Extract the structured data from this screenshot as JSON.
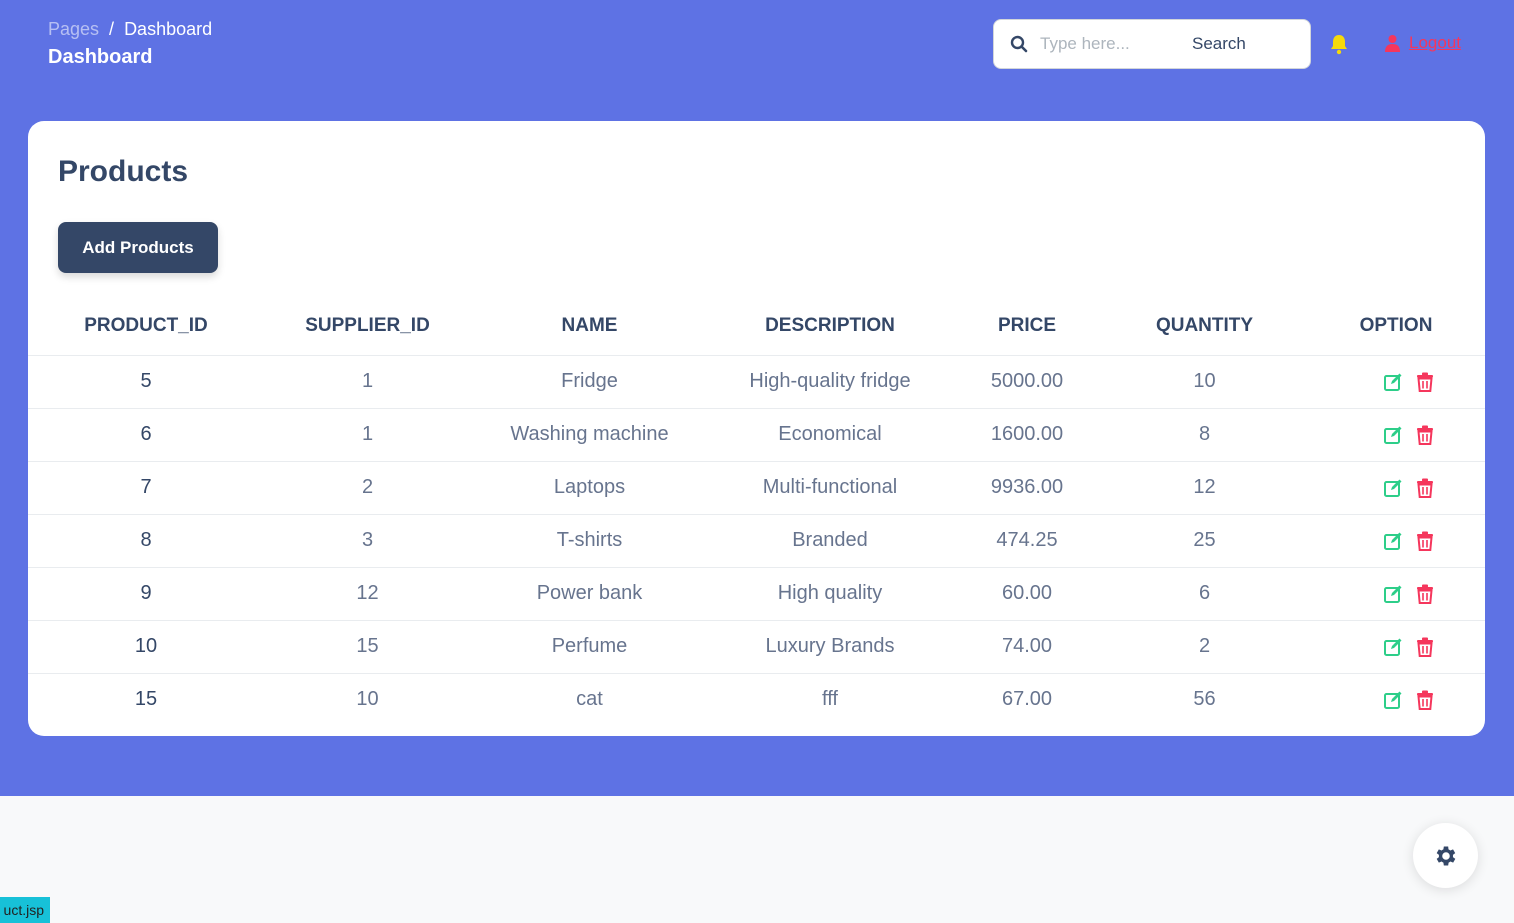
{
  "breadcrumb": {
    "parent": "Pages",
    "separator": "/",
    "current": "Dashboard"
  },
  "header": {
    "title": "Dashboard"
  },
  "search": {
    "placeholder": "Type here...",
    "button_label": "Search",
    "icon": "search-icon"
  },
  "notifications": {
    "icon": "bell-icon",
    "color": "#f5d90a"
  },
  "logout": {
    "label": "Logout",
    "icon": "user-icon",
    "color": "#f5365c"
  },
  "card": {
    "title": "Products",
    "add_button_label": "Add Products"
  },
  "table": {
    "columns": [
      "PRODUCT_ID",
      "SUPPLIER_ID",
      "NAME",
      "DESCRIPTION",
      "PRICE",
      "QUANTITY",
      "OPTION"
    ],
    "rows": [
      {
        "product_id": "5",
        "supplier_id": "1",
        "name": "Fridge",
        "description": "High-quality fridge",
        "price": "5000.00",
        "quantity": "10"
      },
      {
        "product_id": "6",
        "supplier_id": "1",
        "name": "Washing machine",
        "description": "Economical",
        "price": "1600.00",
        "quantity": "8"
      },
      {
        "product_id": "7",
        "supplier_id": "2",
        "name": "Laptops",
        "description": "Multi-functional",
        "price": "9936.00",
        "quantity": "12"
      },
      {
        "product_id": "8",
        "supplier_id": "3",
        "name": "T-shirts",
        "description": "Branded",
        "price": "474.25",
        "quantity": "25"
      },
      {
        "product_id": "9",
        "supplier_id": "12",
        "name": "Power bank",
        "description": "High quality",
        "price": "60.00",
        "quantity": "6"
      },
      {
        "product_id": "10",
        "supplier_id": "15",
        "name": "Perfume",
        "description": "Luxury Brands",
        "price": "74.00",
        "quantity": "2"
      },
      {
        "product_id": "15",
        "supplier_id": "10",
        "name": "cat",
        "description": "fff",
        "price": "67.00",
        "quantity": "56"
      }
    ],
    "option_icons": {
      "edit": "edit-icon",
      "delete": "trash-icon",
      "edit_color": "#2dce89",
      "delete_color": "#f5365c"
    }
  },
  "settings_fab": {
    "icon": "gear-icon"
  },
  "status_tag": {
    "text": "uct.jsp"
  },
  "colors": {
    "primary_bg": "#5e72e4",
    "text_dark": "#344767",
    "text_muted": "#67748e"
  }
}
